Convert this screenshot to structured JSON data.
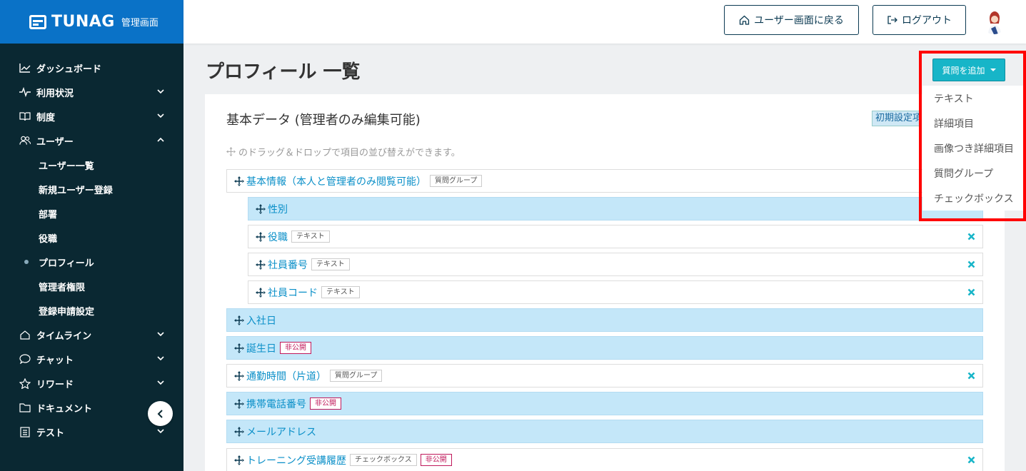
{
  "brand": {
    "name": "TUNAG",
    "subtitle": "管理画面"
  },
  "sidebar": {
    "items": [
      {
        "label": "ダッシュボード",
        "icon": "chart-icon"
      },
      {
        "label": "利用状況",
        "icon": "pulse-icon",
        "expandable": true
      },
      {
        "label": "制度",
        "icon": "book-icon",
        "expandable": true
      },
      {
        "label": "ユーザー",
        "icon": "users-icon",
        "expanded": true
      },
      {
        "label": "ユーザー一覧"
      },
      {
        "label": "新規ユーザー登録"
      },
      {
        "label": "部署"
      },
      {
        "label": "役職"
      },
      {
        "label": "プロフィール",
        "active": true
      },
      {
        "label": "管理者権限"
      },
      {
        "label": "登録申請設定"
      },
      {
        "label": "タイムライン",
        "icon": "home-icon",
        "expandable": true
      },
      {
        "label": "チャット",
        "icon": "chat-icon",
        "expandable": true
      },
      {
        "label": "リワード",
        "icon": "star-icon",
        "expandable": true
      },
      {
        "label": "ドキュメント",
        "icon": "folder-icon"
      },
      {
        "label": "テスト",
        "icon": "list-icon",
        "expandable": true
      }
    ]
  },
  "header": {
    "back_label": "ユーザー画面に戻る",
    "logout_label": "ログアウト"
  },
  "main": {
    "title": "プロフィール 一覧",
    "section_title": "基本データ (管理者のみ編集可能)",
    "init_badge": "初期設定項目",
    "hint": "のドラッグ＆ドロップで項目の並び替えができます。",
    "rows": [
      {
        "label": "基本情報（本人と管理者のみ閲覧可能）",
        "tags": [
          "質問グループ"
        ]
      },
      {
        "label": "性別"
      },
      {
        "label": "役職",
        "tags": [
          "テキスト"
        ]
      },
      {
        "label": "社員番号",
        "tags": [
          "テキスト"
        ]
      },
      {
        "label": "社員コード",
        "tags": [
          "テキスト"
        ]
      },
      {
        "label": "入社日"
      },
      {
        "label": "誕生日",
        "private": "非公開"
      },
      {
        "label": "通勤時間（片道）",
        "tags": [
          "質問グループ"
        ]
      },
      {
        "label": "携帯電話番号",
        "private": "非公開"
      },
      {
        "label": "メールアドレス"
      },
      {
        "label": "トレーニング受講履歴",
        "tags": [
          "チェックボックス"
        ],
        "private": "非公開"
      }
    ]
  },
  "add_menu": {
    "button_label": "質問を追加",
    "items": [
      "テキスト",
      "詳細項目",
      "画像つき詳細項目",
      "質問グループ",
      "チェックボックス"
    ]
  },
  "colors": {
    "brand": "#0a72c7",
    "sidebar": "#0a2832",
    "accent": "#17b5c8",
    "highlight_row": "#c4e7f9",
    "private": "#c0195b",
    "frame": "#ff0000"
  }
}
